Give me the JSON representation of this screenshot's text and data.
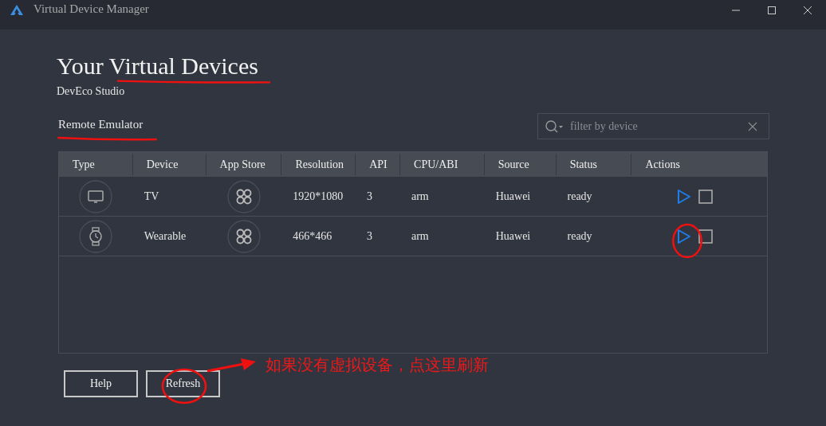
{
  "window": {
    "title": "Virtual Device Manager"
  },
  "heading": "Your Virtual Devices",
  "subtitle": "DevEco Studio",
  "section": "Remote Emulator",
  "search": {
    "placeholder": "filter by device"
  },
  "table": {
    "columns": [
      "Type",
      "Device",
      "App Store",
      "Resolution",
      "API",
      "CPU/ABI",
      "Source",
      "Status",
      "Actions"
    ],
    "rows": [
      {
        "kind": "tv",
        "device": "TV",
        "resolution": "1920*1080",
        "api": "3",
        "cpu": "arm",
        "source": "Huawei",
        "status": "ready"
      },
      {
        "kind": "wearable",
        "device": "Wearable",
        "resolution": "466*466",
        "api": "3",
        "cpu": "arm",
        "source": "Huawei",
        "status": "ready"
      }
    ]
  },
  "buttons": [
    "Help",
    "Refresh"
  ],
  "annotations": [
    {
      "kind": "underline"
    },
    {
      "kind": "underline"
    },
    {
      "kind": "circle"
    },
    {
      "kind": "circle"
    },
    {
      "kind": "arrow"
    },
    {
      "kind": "note",
      "text": "如果没有虚拟设备，点这里刷新"
    }
  ]
}
